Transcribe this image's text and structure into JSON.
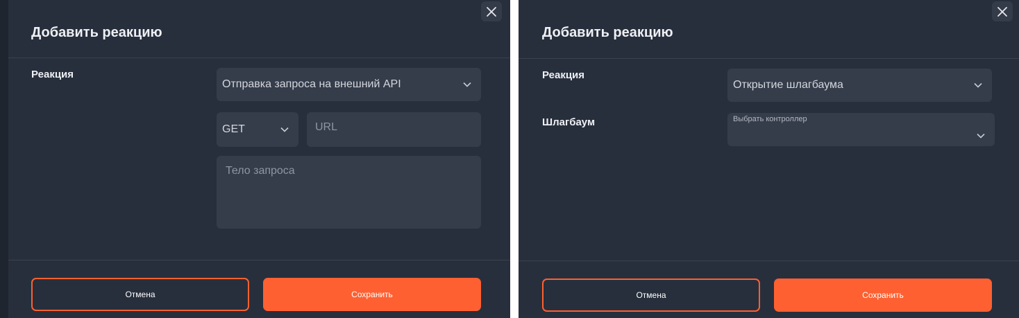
{
  "left_dialog": {
    "title": "Добавить реакцию",
    "reaction_label": "Реакция",
    "reaction_value": "Отправка запроса на внешний API",
    "method_value": "GET",
    "url_placeholder": "URL",
    "body_placeholder": "Тело запроса",
    "cancel_label": "Отмена",
    "save_label": "Сохранить"
  },
  "right_dialog": {
    "title": "Добавить реакцию",
    "reaction_label": "Реакция",
    "reaction_value": "Открытие шлагбаума",
    "barrier_label": "Шлагбаум",
    "controller_label": "Выбрать контроллер",
    "controller_value": "",
    "cancel_label": "Отмена",
    "save_label": "Сохранить"
  },
  "icons": {
    "close": "close-icon",
    "dropdown": "chevron-down-icon"
  },
  "colors": {
    "dialog_bg": "#282f3c",
    "field_bg": "#353c4a",
    "accent": "#ff6031"
  }
}
